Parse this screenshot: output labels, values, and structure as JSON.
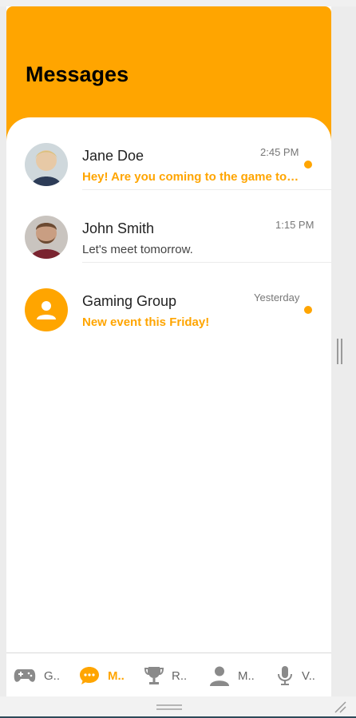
{
  "header": {
    "title": "Messages"
  },
  "conversations": [
    {
      "name": "Jane Doe",
      "time": "2:45 PM",
      "preview": "Hey! Are you coming to the game tonight?",
      "unread": true,
      "avatar": "jane-avatar"
    },
    {
      "name": "John Smith",
      "time": "1:15 PM",
      "preview": "Let's meet tomorrow.",
      "unread": false,
      "avatar": "john-avatar"
    },
    {
      "name": "Gaming Group",
      "time": "Yesterday",
      "preview": "New event this Friday!",
      "unread": true,
      "avatar": "group-icon"
    }
  ],
  "bottom_nav": [
    {
      "label": "G..",
      "icon": "gamepad-icon",
      "active": false
    },
    {
      "label": "M..",
      "icon": "chat-bubble-icon",
      "active": true
    },
    {
      "label": "R..",
      "icon": "trophy-icon",
      "active": false
    },
    {
      "label": "M..",
      "icon": "person-icon",
      "active": false
    },
    {
      "label": "V..",
      "icon": "microphone-icon",
      "active": false
    }
  ],
  "colors": {
    "accent": "#ffa500",
    "text": "#222222",
    "muted": "#777777"
  }
}
